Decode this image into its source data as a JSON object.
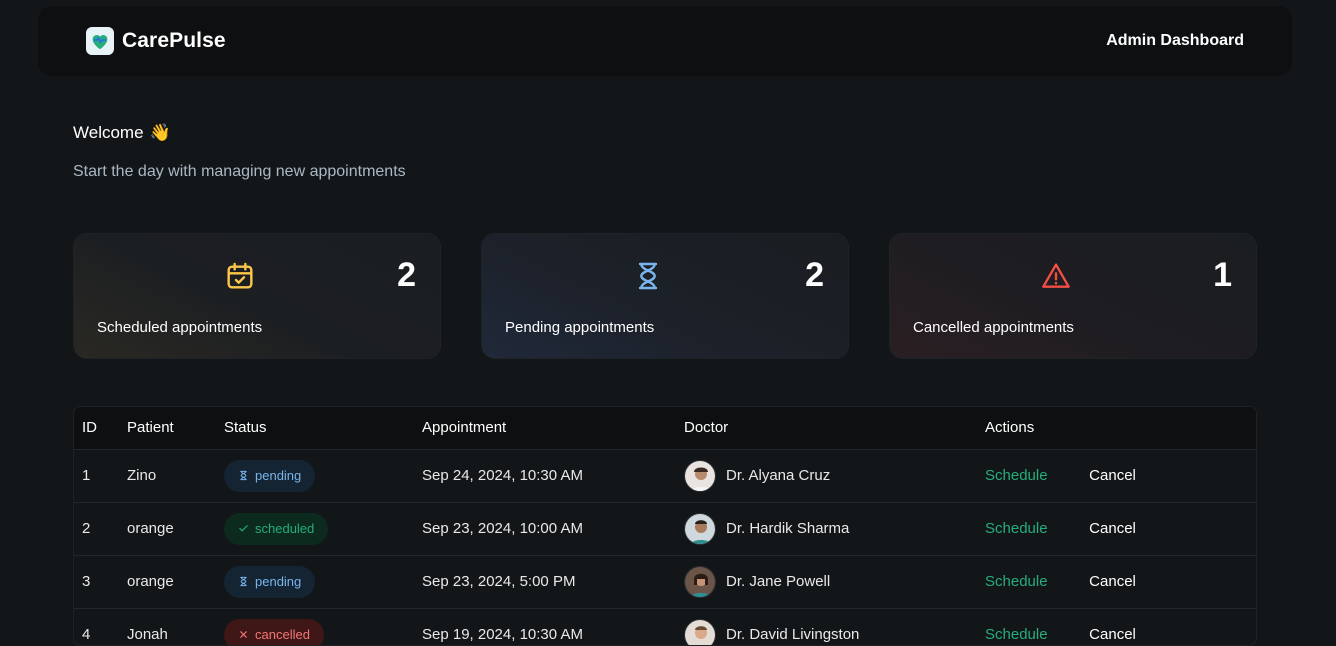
{
  "header": {
    "brand": "CarePulse",
    "title": "Admin Dashboard"
  },
  "welcome": {
    "title": "Welcome",
    "emoji": "👋",
    "subtitle": "Start the day with managing new appointments"
  },
  "stats": [
    {
      "count": "2",
      "label": "Scheduled appointments",
      "icon": "calendar-check-icon",
      "color": "#fdc84a"
    },
    {
      "count": "2",
      "label": "Pending appointments",
      "icon": "hourglass-icon",
      "color": "#79b5ec"
    },
    {
      "count": "1",
      "label": "Cancelled appointments",
      "icon": "alert-triangle-icon",
      "color": "#f24e43"
    }
  ],
  "table": {
    "columns": [
      "ID",
      "Patient",
      "Status",
      "Appointment",
      "Doctor",
      "Actions"
    ],
    "rows": [
      {
        "id": "1",
        "patient": "Zino",
        "status": "pending",
        "appointment": "Sep 24, 2024, 10:30 AM",
        "doctor": "Dr. Alyana Cruz",
        "schedule": "Schedule",
        "cancel": "Cancel"
      },
      {
        "id": "2",
        "patient": "orange",
        "status": "scheduled",
        "appointment": "Sep 23, 2024, 10:00 AM",
        "doctor": "Dr. Hardik Sharma",
        "schedule": "Schedule",
        "cancel": "Cancel"
      },
      {
        "id": "3",
        "patient": "orange",
        "status": "pending",
        "appointment": "Sep 23, 2024, 5:00 PM",
        "doctor": "Dr. Jane Powell",
        "schedule": "Schedule",
        "cancel": "Cancel"
      },
      {
        "id": "4",
        "patient": "Jonah",
        "status": "cancelled",
        "appointment": "Sep 19, 2024, 10:30 AM",
        "doctor": "Dr. David Livingston",
        "schedule": "Schedule",
        "cancel": "Cancel"
      }
    ]
  },
  "colors": {
    "accent_green": "#24ae7c",
    "pending_blue": "#79b5ec",
    "cancel_red": "#f37877",
    "background": "#131619"
  }
}
